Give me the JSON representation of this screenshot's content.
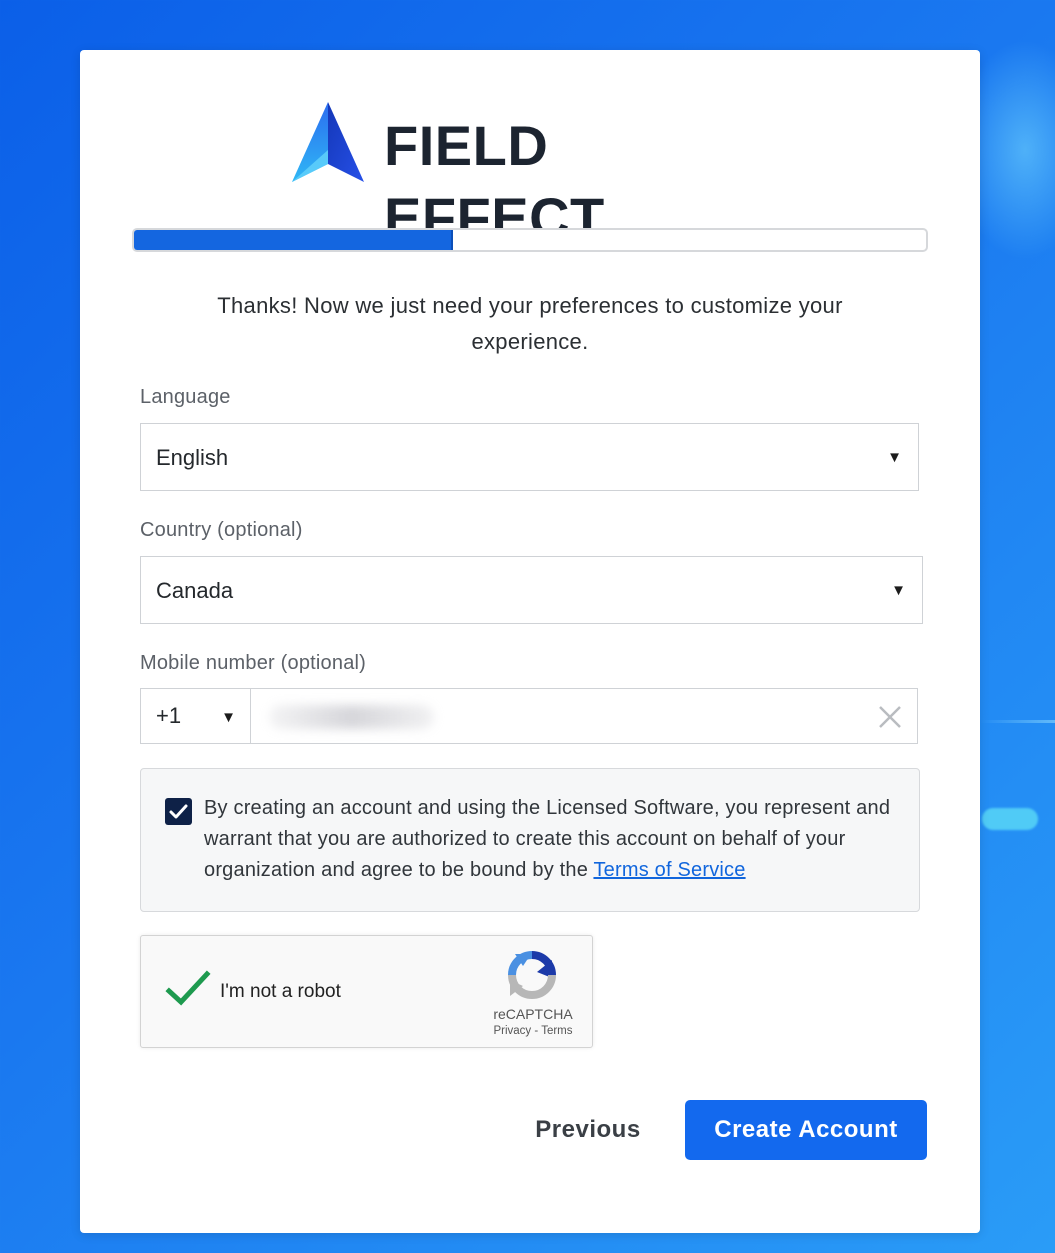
{
  "brand": {
    "name": "FIELD EFFECT",
    "logo_icon": "field-effect-logo-icon"
  },
  "progress": {
    "fraction": 0.4
  },
  "intro": {
    "text": "Thanks! Now we just need your preferences to customize your experience."
  },
  "language": {
    "label": "Language",
    "value": "English"
  },
  "country": {
    "label": "Country (optional)",
    "value": "Canada"
  },
  "mobile": {
    "label": "Mobile number (optional)",
    "code": "+1",
    "clear_icon": "close-icon"
  },
  "terms": {
    "checked": true,
    "text": "By creating an account and using the Licensed Software, you represent and warrant that you are authorized to create this account on behalf of your organization and agree to be bound by the ",
    "link": "Terms of Service"
  },
  "captcha": {
    "label": "I'm not a robot",
    "brand": "reCAPTCHA",
    "privacy": "Privacy",
    "separator": " - ",
    "terms": "Terms",
    "status": "checked"
  },
  "buttons": {
    "previous": "Previous",
    "create": "Create Account"
  },
  "colors": {
    "accent": "#1369ee",
    "progress": "#1466e0",
    "checkbox": "#0e2147",
    "link": "#1166dd"
  }
}
